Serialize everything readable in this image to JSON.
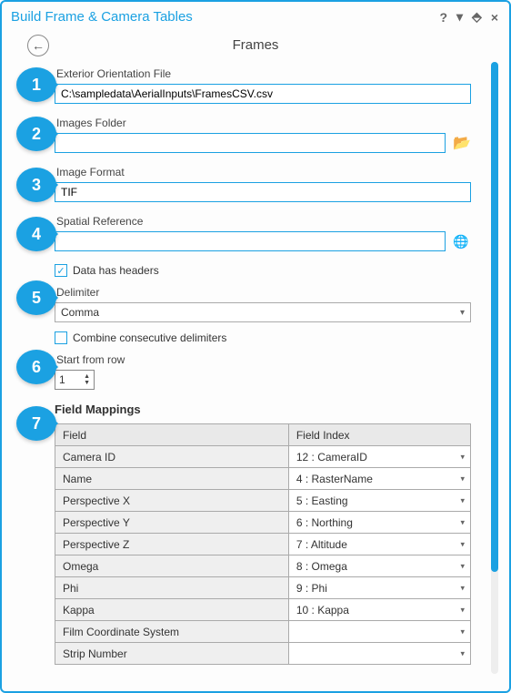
{
  "window": {
    "title": "Build Frame & Camera Tables",
    "heading": "Frames",
    "help_icon": "?",
    "dropdown_icon": "▾",
    "pin_icon": "⬘",
    "close_icon": "×"
  },
  "callouts": {
    "c1": "1",
    "c2": "2",
    "c3": "3",
    "c4": "4",
    "c5": "5",
    "c6": "6",
    "c7": "7"
  },
  "fields": {
    "exterior": {
      "label": "Exterior Orientation File",
      "value": "C:\\sampledata\\AerialInputs\\FramesCSV.csv"
    },
    "images_folder": {
      "label": "Images Folder",
      "value": ""
    },
    "image_format": {
      "label": "Image Format",
      "value": "TIF"
    },
    "spatial_ref": {
      "label": "Spatial Reference",
      "value": ""
    },
    "data_has_headers": {
      "label": "Data has headers",
      "checked": "✓"
    },
    "delimiter": {
      "label": "Delimiter",
      "value": "Comma"
    },
    "combine": {
      "label": "Combine consecutive delimiters",
      "checked": ""
    },
    "start_row": {
      "label": "Start from row",
      "value": "1"
    }
  },
  "mappings": {
    "title": "Field Mappings",
    "header_field": "Field",
    "header_index": "Field Index",
    "rows": [
      {
        "field": "Camera ID",
        "index": "12 : CameraID"
      },
      {
        "field": "Name",
        "index": "4 : RasterName"
      },
      {
        "field": "Perspective X",
        "index": "5 : Easting"
      },
      {
        "field": "Perspective Y",
        "index": "6 : Northing"
      },
      {
        "field": "Perspective Z",
        "index": "7 : Altitude"
      },
      {
        "field": "Omega",
        "index": "8 : Omega"
      },
      {
        "field": "Phi",
        "index": "9 : Phi"
      },
      {
        "field": "Kappa",
        "index": "10 : Kappa"
      },
      {
        "field": "Film Coordinate System",
        "index": ""
      },
      {
        "field": "Strip Number",
        "index": ""
      }
    ]
  }
}
